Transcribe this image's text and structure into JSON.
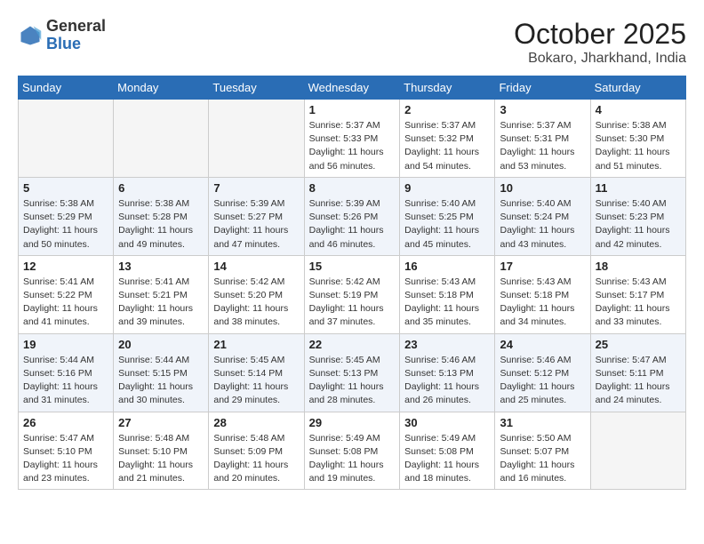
{
  "header": {
    "logo_general": "General",
    "logo_blue": "Blue",
    "title": "October 2025",
    "subtitle": "Bokaro, Jharkhand, India"
  },
  "weekdays": [
    "Sunday",
    "Monday",
    "Tuesday",
    "Wednesday",
    "Thursday",
    "Friday",
    "Saturday"
  ],
  "weeks": [
    [
      {
        "day": "",
        "info": ""
      },
      {
        "day": "",
        "info": ""
      },
      {
        "day": "",
        "info": ""
      },
      {
        "day": "1",
        "info": "Sunrise: 5:37 AM\nSunset: 5:33 PM\nDaylight: 11 hours\nand 56 minutes."
      },
      {
        "day": "2",
        "info": "Sunrise: 5:37 AM\nSunset: 5:32 PM\nDaylight: 11 hours\nand 54 minutes."
      },
      {
        "day": "3",
        "info": "Sunrise: 5:37 AM\nSunset: 5:31 PM\nDaylight: 11 hours\nand 53 minutes."
      },
      {
        "day": "4",
        "info": "Sunrise: 5:38 AM\nSunset: 5:30 PM\nDaylight: 11 hours\nand 51 minutes."
      }
    ],
    [
      {
        "day": "5",
        "info": "Sunrise: 5:38 AM\nSunset: 5:29 PM\nDaylight: 11 hours\nand 50 minutes."
      },
      {
        "day": "6",
        "info": "Sunrise: 5:38 AM\nSunset: 5:28 PM\nDaylight: 11 hours\nand 49 minutes."
      },
      {
        "day": "7",
        "info": "Sunrise: 5:39 AM\nSunset: 5:27 PM\nDaylight: 11 hours\nand 47 minutes."
      },
      {
        "day": "8",
        "info": "Sunrise: 5:39 AM\nSunset: 5:26 PM\nDaylight: 11 hours\nand 46 minutes."
      },
      {
        "day": "9",
        "info": "Sunrise: 5:40 AM\nSunset: 5:25 PM\nDaylight: 11 hours\nand 45 minutes."
      },
      {
        "day": "10",
        "info": "Sunrise: 5:40 AM\nSunset: 5:24 PM\nDaylight: 11 hours\nand 43 minutes."
      },
      {
        "day": "11",
        "info": "Sunrise: 5:40 AM\nSunset: 5:23 PM\nDaylight: 11 hours\nand 42 minutes."
      }
    ],
    [
      {
        "day": "12",
        "info": "Sunrise: 5:41 AM\nSunset: 5:22 PM\nDaylight: 11 hours\nand 41 minutes."
      },
      {
        "day": "13",
        "info": "Sunrise: 5:41 AM\nSunset: 5:21 PM\nDaylight: 11 hours\nand 39 minutes."
      },
      {
        "day": "14",
        "info": "Sunrise: 5:42 AM\nSunset: 5:20 PM\nDaylight: 11 hours\nand 38 minutes."
      },
      {
        "day": "15",
        "info": "Sunrise: 5:42 AM\nSunset: 5:19 PM\nDaylight: 11 hours\nand 37 minutes."
      },
      {
        "day": "16",
        "info": "Sunrise: 5:43 AM\nSunset: 5:18 PM\nDaylight: 11 hours\nand 35 minutes."
      },
      {
        "day": "17",
        "info": "Sunrise: 5:43 AM\nSunset: 5:18 PM\nDaylight: 11 hours\nand 34 minutes."
      },
      {
        "day": "18",
        "info": "Sunrise: 5:43 AM\nSunset: 5:17 PM\nDaylight: 11 hours\nand 33 minutes."
      }
    ],
    [
      {
        "day": "19",
        "info": "Sunrise: 5:44 AM\nSunset: 5:16 PM\nDaylight: 11 hours\nand 31 minutes."
      },
      {
        "day": "20",
        "info": "Sunrise: 5:44 AM\nSunset: 5:15 PM\nDaylight: 11 hours\nand 30 minutes."
      },
      {
        "day": "21",
        "info": "Sunrise: 5:45 AM\nSunset: 5:14 PM\nDaylight: 11 hours\nand 29 minutes."
      },
      {
        "day": "22",
        "info": "Sunrise: 5:45 AM\nSunset: 5:13 PM\nDaylight: 11 hours\nand 28 minutes."
      },
      {
        "day": "23",
        "info": "Sunrise: 5:46 AM\nSunset: 5:13 PM\nDaylight: 11 hours\nand 26 minutes."
      },
      {
        "day": "24",
        "info": "Sunrise: 5:46 AM\nSunset: 5:12 PM\nDaylight: 11 hours\nand 25 minutes."
      },
      {
        "day": "25",
        "info": "Sunrise: 5:47 AM\nSunset: 5:11 PM\nDaylight: 11 hours\nand 24 minutes."
      }
    ],
    [
      {
        "day": "26",
        "info": "Sunrise: 5:47 AM\nSunset: 5:10 PM\nDaylight: 11 hours\nand 23 minutes."
      },
      {
        "day": "27",
        "info": "Sunrise: 5:48 AM\nSunset: 5:10 PM\nDaylight: 11 hours\nand 21 minutes."
      },
      {
        "day": "28",
        "info": "Sunrise: 5:48 AM\nSunset: 5:09 PM\nDaylight: 11 hours\nand 20 minutes."
      },
      {
        "day": "29",
        "info": "Sunrise: 5:49 AM\nSunset: 5:08 PM\nDaylight: 11 hours\nand 19 minutes."
      },
      {
        "day": "30",
        "info": "Sunrise: 5:49 AM\nSunset: 5:08 PM\nDaylight: 11 hours\nand 18 minutes."
      },
      {
        "day": "31",
        "info": "Sunrise: 5:50 AM\nSunset: 5:07 PM\nDaylight: 11 hours\nand 16 minutes."
      },
      {
        "day": "",
        "info": ""
      }
    ]
  ]
}
